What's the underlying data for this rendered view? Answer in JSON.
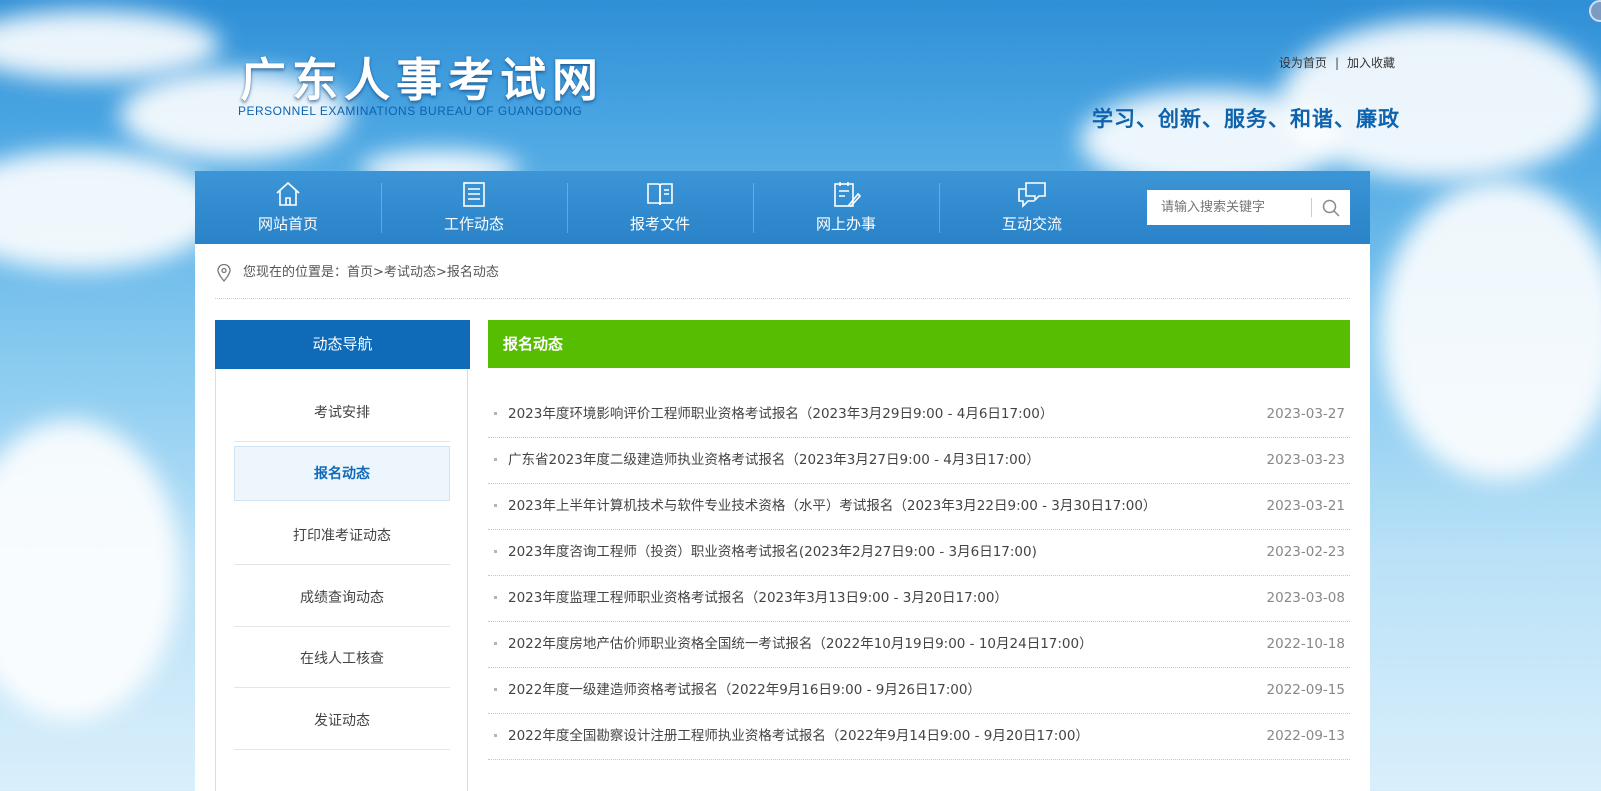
{
  "site": {
    "title": "广东人事考试网",
    "subtitle": "PERSONNEL EXAMINATIONS BUREAU OF GUANGDONG",
    "slogan": "学习、创新、服务、和谐、廉政"
  },
  "top_links": {
    "set_home": "设为首页",
    "separator": "|",
    "add_favorite": "加入收藏"
  },
  "nav": {
    "items": [
      {
        "label": "网站首页",
        "icon": "home-icon"
      },
      {
        "label": "工作动态",
        "icon": "document-list-icon"
      },
      {
        "label": "报考文件",
        "icon": "open-book-icon"
      },
      {
        "label": "网上办事",
        "icon": "clipboard-pen-icon"
      },
      {
        "label": "互动交流",
        "icon": "chat-bubbles-icon"
      }
    ]
  },
  "search": {
    "placeholder": "请输入搜索关键字",
    "icon": "search-icon"
  },
  "breadcrumb": {
    "prefix": "您现在的位置是：",
    "items": [
      "首页",
      "考试动态",
      "报名动态"
    ],
    "separator": ">",
    "icon": "location-pin-icon"
  },
  "sidebar": {
    "title": "动态导航",
    "items": [
      {
        "label": "考试安排"
      },
      {
        "label": "报名动态",
        "active": true
      },
      {
        "label": "打印准考证动态"
      },
      {
        "label": "成绩查询动态"
      },
      {
        "label": "在线人工核查"
      },
      {
        "label": "发证动态"
      }
    ]
  },
  "main": {
    "title": "报名动态",
    "articles": [
      {
        "title": "2023年度环境影响评价工程师职业资格考试报名（2023年3月29日9:00 - 4月6日17:00）",
        "date": "2023-03-27"
      },
      {
        "title": "广东省2023年度二级建造师执业资格考试报名（2023年3月27日9:00 - 4月3日17:00）",
        "date": "2023-03-23"
      },
      {
        "title": "2023年上半年计算机技术与软件专业技术资格（水平）考试报名（2023年3月22日9:00 - 3月30日17:00）",
        "date": "2023-03-21"
      },
      {
        "title": "2023年度咨询工程师（投资）职业资格考试报名(2023年2月27日9:00 - 3月6日17:00)",
        "date": "2023-02-23"
      },
      {
        "title": "2023年度监理工程师职业资格考试报名（2023年3月13日9:00 - 3月20日17:00）",
        "date": "2023-03-08"
      },
      {
        "title": "2022年度房地产估价师职业资格全国统一考试报名（2022年10月19日9:00 - 10月24日17:00）",
        "date": "2022-10-18"
      },
      {
        "title": "2022年度一级建造师资格考试报名（2022年9月16日9:00 - 9月26日17:00）",
        "date": "2022-09-15"
      },
      {
        "title": "2022年度全国勘察设计注册工程师执业资格考试报名（2022年9月14日9:00 - 9月20日17:00）",
        "date": "2022-09-13"
      }
    ]
  },
  "colors": {
    "nav_blue": "#2a82c8",
    "sidebar_head": "#0f6ab8",
    "main_head_green": "#56bd00",
    "slogan": "#0f63ad"
  }
}
